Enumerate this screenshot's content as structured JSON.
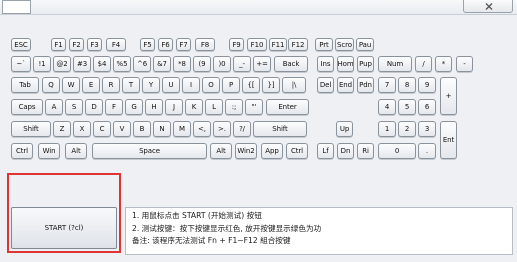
{
  "keyboard_rows": [
    {
      "cls": "row-fn",
      "keys": [
        "ESC",
        "F1",
        "F2",
        "F3",
        "F4",
        "F5",
        "F6",
        "F7",
        "F8",
        "F9",
        "F10",
        "F11",
        "F12",
        "Prt",
        "Scro",
        "Pau"
      ]
    },
    {
      "cls": "row-num",
      "keys": [
        "~`",
        "!1",
        "@2",
        "#3",
        "$4",
        "%5",
        "^6",
        "&7",
        "*8",
        "(9",
        ")0",
        "_-",
        "+=",
        "Back",
        "Ins",
        "Hom",
        "Pup",
        "Num",
        "/",
        "*",
        "-"
      ]
    },
    {
      "cls": "row-q",
      "keys": [
        "Tab",
        "Q",
        "W",
        "E",
        "R",
        "T",
        "Y",
        "U",
        "I",
        "O",
        "P",
        "{[",
        "}]",
        "|\\",
        "Del",
        "End",
        "Pdn",
        "7",
        "8",
        "9",
        "+"
      ]
    },
    {
      "cls": "row-a",
      "keys": [
        "Caps",
        "A",
        "S",
        "D",
        "F",
        "G",
        "H",
        "J",
        "K",
        "L",
        ":;",
        "\"'",
        "Enter",
        "4",
        "5",
        "6"
      ]
    },
    {
      "cls": "row-z",
      "keys": [
        "Shift",
        "Z",
        "X",
        "C",
        "V",
        "B",
        "N",
        "M",
        "<,",
        ">.",
        "?/",
        "Shift",
        "Up",
        "1",
        "2",
        "3",
        "Ent"
      ]
    },
    {
      "cls": "row-ctrl",
      "keys": [
        "Ctrl",
        "Win",
        "Alt",
        "Space",
        "Alt",
        "Win2",
        "App",
        "Ctrl",
        "Lf",
        "Dn",
        "Ri",
        "0",
        "."
      ]
    }
  ],
  "start_button": {
    "label": "START (?cl)"
  },
  "info": {
    "line1": "1.  用鼠标点击 START (开始测试) 按钮",
    "line2": "2.  测试按键：按下按键显示红色, 放开按键显示绿色为功",
    "line3": "备注: 该程序无法测试 Fn + F1~F12 組合按键"
  }
}
